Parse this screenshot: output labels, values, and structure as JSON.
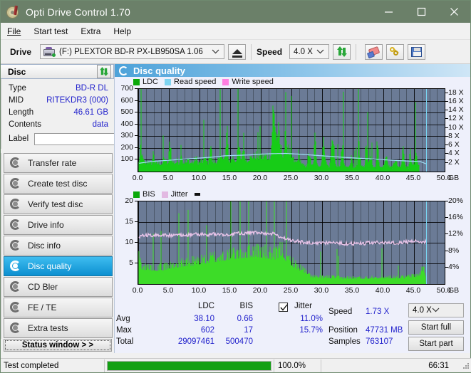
{
  "window": {
    "title": "Opti Drive Control 1.70",
    "icon": "disc-marker-icon",
    "minimize": "minimize-icon",
    "maximize": "maximize-icon",
    "close": "close-icon",
    "titlebar_color": "#6b8069"
  },
  "menu": {
    "items": [
      {
        "label": "File"
      },
      {
        "label": "Start test"
      },
      {
        "label": "Extra"
      },
      {
        "label": "Help"
      }
    ]
  },
  "toolbar": {
    "drive_label": "Drive",
    "drive_value": "(F:)  PLEXTOR BD-R  PX-LB950SA 1.06",
    "eject_icon": "eject-icon",
    "speed_label": "Speed",
    "speed_value": "4.0 X",
    "refresh_icon": "green-refresh-arrows-icon",
    "erase_icon": "eraser-icon",
    "keys_icon": "keys-icon",
    "save_icon": "floppy-save-icon"
  },
  "disc_panel": {
    "header": "Disc",
    "refresh_icon": "green-refresh-arrows-icon",
    "rows": [
      {
        "key": "Type",
        "value": "BD-R DL"
      },
      {
        "key": "MID",
        "value": "RITEKDR3 (000)"
      },
      {
        "key": "Length",
        "value": "46.61 GB"
      },
      {
        "key": "Contents",
        "value": "data"
      }
    ],
    "label_key": "Label",
    "label_value": "",
    "label_placeholder": "",
    "label_button_icon": "disc-icon"
  },
  "sidebar": {
    "items": [
      {
        "label": "Transfer rate",
        "icon": "disc-test-icon",
        "active": false
      },
      {
        "label": "Create test disc",
        "icon": "disc-burn-icon",
        "active": false
      },
      {
        "label": "Verify test disc",
        "icon": "disc-verify-icon",
        "active": false
      },
      {
        "label": "Drive info",
        "icon": "drive-info-icon",
        "active": false
      },
      {
        "label": "Disc info",
        "icon": "disc-info-icon",
        "active": false
      },
      {
        "label": "Disc quality",
        "icon": "disc-quality-icon",
        "active": true
      },
      {
        "label": "CD Bler",
        "icon": "cd-bler-icon",
        "active": false
      },
      {
        "label": "FE / TE",
        "icon": "fe-te-icon",
        "active": false
      },
      {
        "label": "Extra tests",
        "icon": "extra-tests-icon",
        "active": false
      }
    ],
    "status_window_button": "Status window > >"
  },
  "panel": {
    "title": "Disc quality",
    "icon": "disc-quality-icon"
  },
  "stats": {
    "col_ldc": "LDC",
    "col_bis": "BIS",
    "jitter_label": "Jitter",
    "jitter_checked": true,
    "rows": [
      {
        "name": "Avg",
        "ldc": "38.10",
        "bis": "0.66",
        "jitter": "11.0%"
      },
      {
        "name": "Max",
        "ldc": "602",
        "bis": "17",
        "jitter": "15.7%"
      },
      {
        "name": "Total",
        "ldc": "29097461",
        "bis": "500470",
        "jitter": ""
      }
    ],
    "speed_label": "Speed",
    "speed_value": "1.73 X",
    "position_label": "Position",
    "position_value": "47731 MB",
    "samples_label": "Samples",
    "samples_value": "763107",
    "speed_select": "4.0 X",
    "start_full": "Start full",
    "start_part": "Start part"
  },
  "statusbar": {
    "message": "Test completed",
    "progress_percent": "100.0%",
    "progress_value": 100,
    "elapsed": "66:31"
  },
  "chart_data": [
    {
      "type": "area",
      "title": "LDC / Read speed",
      "xlabel": "GB",
      "ylabel": "LDC",
      "xlim": [
        0,
        50
      ],
      "ylim": [
        0,
        700
      ],
      "y2lim": [
        0,
        18.9
      ],
      "y2label": "X",
      "xticks": [
        "0.0",
        "5.0",
        "10.0",
        "15.0",
        "20.0",
        "25.0",
        "30.0",
        "35.0",
        "40.0",
        "45.0",
        "50.0"
      ],
      "xunit": "GB",
      "yticks": [
        100,
        200,
        300,
        400,
        500,
        600,
        700
      ],
      "y2ticks": [
        "2 X",
        "4 X",
        "6 X",
        "8 X",
        "10 X",
        "12 X",
        "14 X",
        "16 X",
        "18 X"
      ],
      "grid": true,
      "legend": [
        {
          "name": "LDC",
          "color": "#0aa80a"
        },
        {
          "name": "Read speed",
          "color": "#7fd4f0"
        },
        {
          "name": "Write speed",
          "color": "#ff7fe0"
        }
      ],
      "cursor_x": 47.0,
      "series": [
        {
          "name": "LDC",
          "color": "#17cc17",
          "type": "area",
          "x": [
            0.0,
            0.3,
            0.6,
            0.9,
            1.2,
            1.5,
            1.8,
            2.1,
            2.4,
            2.7,
            3.0,
            3.3,
            3.6,
            3.9,
            4.2,
            4.5,
            4.8,
            5.1,
            5.4,
            5.7,
            6.0,
            6.3,
            6.6,
            6.9,
            7.2,
            7.5,
            7.8,
            8.1,
            8.4,
            8.7,
            9.0,
            9.3,
            9.6,
            9.9,
            10.2,
            10.5,
            10.8,
            11.1,
            11.4,
            11.7,
            12.0,
            12.3,
            12.6,
            12.9,
            13.2,
            13.5,
            13.8,
            14.1,
            14.4,
            14.7,
            15.0,
            15.3,
            15.6,
            15.9,
            16.2,
            16.5,
            16.8,
            17.1,
            17.4,
            17.7,
            18.0,
            18.3,
            18.6,
            18.9,
            19.2,
            19.5,
            19.8,
            20.1,
            20.4,
            20.7,
            21.0,
            21.3,
            21.6,
            21.9,
            22.2,
            22.5,
            22.8,
            23.1,
            23.4,
            23.7,
            24.0,
            24.3,
            24.6,
            24.9,
            25.2,
            25.5,
            25.8,
            26.1,
            26.4,
            26.7,
            27.0,
            27.3,
            27.6,
            27.9,
            28.2,
            28.5,
            28.8,
            29.1,
            29.4,
            29.7,
            30.0,
            30.3,
            30.6,
            30.9,
            31.2,
            31.5,
            31.8,
            32.1,
            32.4,
            32.7,
            33.0,
            33.3,
            33.6,
            33.9,
            34.2,
            34.5,
            34.8,
            35.1,
            35.4,
            35.7,
            36.0,
            36.3,
            36.6,
            36.9,
            37.2,
            37.5,
            37.8,
            38.1,
            38.4,
            38.7,
            39.0,
            39.3,
            39.6,
            39.9,
            40.2,
            40.5,
            40.8,
            41.1,
            41.4,
            41.7,
            42.0,
            42.3,
            42.6,
            42.9,
            43.2,
            43.5,
            43.8,
            44.1,
            44.4,
            44.7,
            45.0,
            45.3,
            45.6,
            45.9,
            46.2,
            46.5,
            46.8
          ],
          "y": [
            90,
            300,
            130,
            95,
            85,
            120,
            80,
            90,
            210,
            85,
            80,
            95,
            80,
            85,
            150,
            90,
            85,
            350,
            100,
            95,
            90,
            110,
            85,
            260,
            95,
            100,
            90,
            130,
            85,
            95,
            100,
            150,
            95,
            90,
            110,
            95,
            140,
            100,
            90,
            320,
            110,
            100,
            95,
            130,
            100,
            220,
            110,
            140,
            420,
            120,
            110,
            150,
            130,
            110,
            280,
            190,
            120,
            340,
            130,
            120,
            150,
            130,
            160,
            150,
            170,
            140,
            160,
            150,
            150,
            160,
            150,
            170,
            160,
            600,
            560,
            330,
            420,
            250,
            200,
            180,
            400,
            250,
            200,
            160,
            130,
            100,
            90,
            180,
            120,
            70,
            60,
            50,
            120,
            200,
            60,
            70,
            340,
            120,
            60,
            50,
            200,
            330,
            90,
            60,
            50,
            260,
            400,
            70,
            60,
            50,
            90,
            300,
            60,
            50,
            40,
            90,
            150,
            50,
            40,
            60,
            290,
            70,
            50,
            40,
            380,
            90,
            200,
            60,
            50,
            40,
            320,
            70,
            50,
            40,
            120,
            230,
            60,
            50,
            40,
            90,
            160,
            50,
            40,
            60,
            330,
            80,
            50,
            40,
            200,
            90,
            60,
            290,
            70
          ]
        },
        {
          "name": "Read speed",
          "color": "#9fdff7",
          "type": "line",
          "x": [
            0.0,
            2.0,
            4.0,
            6.0,
            8.0,
            10.0,
            12.0,
            14.0,
            16.0,
            18.0,
            20.0,
            22.0,
            24.0,
            26.0,
            28.0,
            30.0,
            32.0,
            34.0,
            36.0,
            38.0,
            40.0,
            42.0,
            44.0,
            46.0,
            46.9
          ],
          "y_speed": [
            1.9,
            2.3,
            2.5,
            2.7,
            2.9,
            3.1,
            3.3,
            3.6,
            3.7,
            3.8,
            4.0,
            4.1,
            4.15,
            4.0,
            3.8,
            3.6,
            3.4,
            3.2,
            3.05,
            2.9,
            2.7,
            2.55,
            2.4,
            2.3,
            1.8
          ]
        }
      ]
    },
    {
      "type": "area",
      "title": "BIS / Jitter",
      "xlabel": "GB",
      "ylabel": "BIS",
      "xlim": [
        0,
        50
      ],
      "ylim": [
        0,
        20
      ],
      "y2lim": [
        0,
        20
      ],
      "y2label": "%",
      "xticks": [
        "0.0",
        "5.0",
        "10.0",
        "15.0",
        "20.0",
        "25.0",
        "30.0",
        "35.0",
        "40.0",
        "45.0",
        "50.0"
      ],
      "xunit": "GB",
      "yticks": [
        5,
        10,
        15,
        20
      ],
      "y2ticks": [
        "4%",
        "8%",
        "12%",
        "16%",
        "20%"
      ],
      "grid": true,
      "legend": [
        {
          "name": "BIS",
          "color": "#0aa80a"
        },
        {
          "name": "Jitter",
          "color": "#e2b9e2"
        }
      ],
      "cursor_x": 47.0,
      "series": [
        {
          "name": "BIS",
          "color": "#3ddc28",
          "type": "area",
          "x": [
            0.0,
            0.5,
            1.0,
            1.5,
            2.0,
            2.5,
            3.0,
            3.5,
            4.0,
            4.5,
            5.0,
            5.5,
            6.0,
            6.5,
            7.0,
            7.5,
            8.0,
            8.5,
            9.0,
            9.5,
            10.0,
            10.5,
            11.0,
            11.5,
            12.0,
            12.5,
            13.0,
            13.5,
            14.0,
            14.5,
            15.0,
            15.5,
            16.0,
            16.5,
            17.0,
            17.5,
            18.0,
            18.5,
            19.0,
            19.5,
            20.0,
            20.5,
            21.0,
            21.5,
            22.0,
            22.5,
            23.0,
            23.5,
            24.0,
            24.5,
            25.0,
            25.5,
            26.0,
            26.5,
            27.0,
            27.5,
            28.0,
            28.5,
            29.0,
            29.5,
            30.0,
            30.5,
            31.0,
            31.5,
            32.0,
            32.5,
            33.0,
            33.5,
            34.0,
            34.5,
            35.0,
            35.5,
            36.0,
            36.5,
            37.0,
            37.5,
            38.0,
            38.5,
            39.0,
            39.5,
            40.0,
            40.5,
            41.0,
            41.5,
            42.0,
            42.5,
            43.0,
            43.5,
            44.0,
            44.5,
            45.0,
            45.5,
            46.0,
            46.5,
            46.9
          ],
          "y": [
            8.0,
            5.0,
            4.8,
            5.0,
            4.6,
            4.8,
            4.5,
            5.0,
            4.7,
            5.0,
            5.2,
            5.4,
            5.6,
            5.8,
            6.0,
            6.1,
            6.2,
            6.3,
            6.4,
            6.6,
            6.8,
            7.0,
            7.2,
            7.3,
            7.5,
            7.6,
            7.8,
            8.0,
            8.2,
            8.3,
            8.5,
            8.6,
            8.8,
            8.9,
            9.0,
            9.1,
            9.2,
            9.3,
            9.4,
            9.3,
            9.2,
            9.0,
            8.8,
            8.6,
            8.4,
            8.6,
            9.5,
            10.0,
            8.0,
            7.0,
            6.5,
            5.5,
            5.0,
            4.5,
            4.0,
            3.0,
            2.4,
            2.2,
            2.0,
            2.0,
            2.0,
            2.0,
            2.0,
            2.0,
            2.0,
            2.0,
            1.8,
            1.8,
            1.8,
            1.8,
            1.8,
            1.8,
            1.8,
            1.8,
            1.8,
            1.8,
            2.0,
            2.0,
            2.0,
            2.0,
            2.0,
            2.0,
            2.0,
            2.0,
            2.0,
            2.0,
            2.0,
            2.0,
            2.2,
            2.2,
            2.4,
            2.6,
            3.0,
            5.0,
            2.0
          ]
        },
        {
          "name": "Jitter",
          "color": "#e8c3e8",
          "type": "line",
          "x": [
            0.0,
            1.0,
            2.0,
            3.0,
            4.0,
            5.0,
            6.0,
            7.0,
            8.0,
            9.0,
            10.0,
            11.0,
            12.0,
            13.0,
            14.0,
            15.0,
            16.0,
            17.0,
            18.0,
            19.0,
            20.0,
            21.0,
            22.0,
            23.0,
            24.0,
            25.0,
            26.0,
            27.0,
            28.0,
            29.0,
            30.0,
            31.0,
            32.0,
            33.0,
            34.0,
            35.0,
            36.0,
            37.0,
            38.0,
            39.0,
            40.0,
            41.0,
            42.0,
            43.0,
            44.0,
            45.0,
            46.0,
            46.6
          ],
          "y": [
            11.5,
            11.8,
            11.8,
            11.7,
            11.8,
            11.8,
            11.9,
            11.9,
            11.9,
            12.0,
            12.0,
            12.0,
            12.0,
            12.0,
            12.0,
            12.1,
            12.2,
            12.3,
            12.4,
            12.5,
            12.4,
            12.3,
            12.1,
            11.6,
            11.0,
            10.5,
            10.3,
            10.1,
            10.0,
            10.0,
            9.9,
            9.9,
            9.9,
            9.8,
            9.8,
            9.8,
            9.9,
            9.9,
            9.9,
            10.0,
            10.0,
            10.0,
            10.0,
            10.1,
            10.2,
            10.4,
            10.3,
            10.3
          ]
        }
      ]
    }
  ]
}
